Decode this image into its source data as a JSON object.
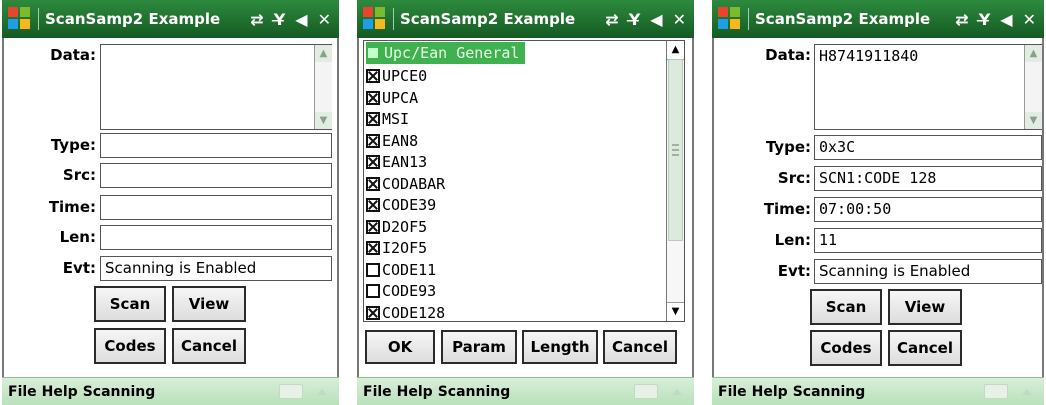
{
  "screens": [
    {
      "title": "ScanSamp2 Example",
      "labels": {
        "data": "Data:",
        "type": "Type:",
        "src": "Src:",
        "time": "Time:",
        "len": "Len:",
        "evt": "Evt:"
      },
      "values": {
        "data": "",
        "type": "",
        "src": "",
        "time": "",
        "len": "",
        "evt": "Scanning is Enabled"
      },
      "buttons": {
        "scan": "Scan",
        "view": "View",
        "codes": "Codes",
        "cancel": "Cancel"
      },
      "menu": [
        "File",
        "Help",
        "Scanning"
      ]
    },
    {
      "title": "ScanSamp2 Example",
      "group_label": "Upc/Ean General",
      "items": [
        {
          "label": "UPCE0",
          "checked": true
        },
        {
          "label": "UPCA",
          "checked": true
        },
        {
          "label": "MSI",
          "checked": true
        },
        {
          "label": "EAN8",
          "checked": true
        },
        {
          "label": "EAN13",
          "checked": true
        },
        {
          "label": "CODABAR",
          "checked": true
        },
        {
          "label": "CODE39",
          "checked": true
        },
        {
          "label": "D2OF5",
          "checked": true
        },
        {
          "label": "I2OF5",
          "checked": true
        },
        {
          "label": "CODE11",
          "checked": false
        },
        {
          "label": "CODE93",
          "checked": false
        },
        {
          "label": "CODE128",
          "checked": true
        }
      ],
      "buttons": {
        "ok": "OK",
        "param": "Param",
        "length": "Length",
        "cancel": "Cancel"
      },
      "menu": [
        "File",
        "Help",
        "Scanning"
      ]
    },
    {
      "title": "ScanSamp2 Example",
      "labels": {
        "data": "Data:",
        "type": "Type:",
        "src": "Src:",
        "time": "Time:",
        "len": "Len:",
        "evt": "Evt:"
      },
      "values": {
        "data": "H8741911840",
        "type": "0x3C",
        "src": "SCN1:CODE 128",
        "time": "07:00:50",
        "len": "11",
        "evt": "Scanning is Enabled"
      },
      "buttons": {
        "scan": "Scan",
        "view": "View",
        "codes": "Codes",
        "cancel": "Cancel"
      },
      "menu": [
        "File",
        "Help",
        "Scanning"
      ]
    }
  ]
}
